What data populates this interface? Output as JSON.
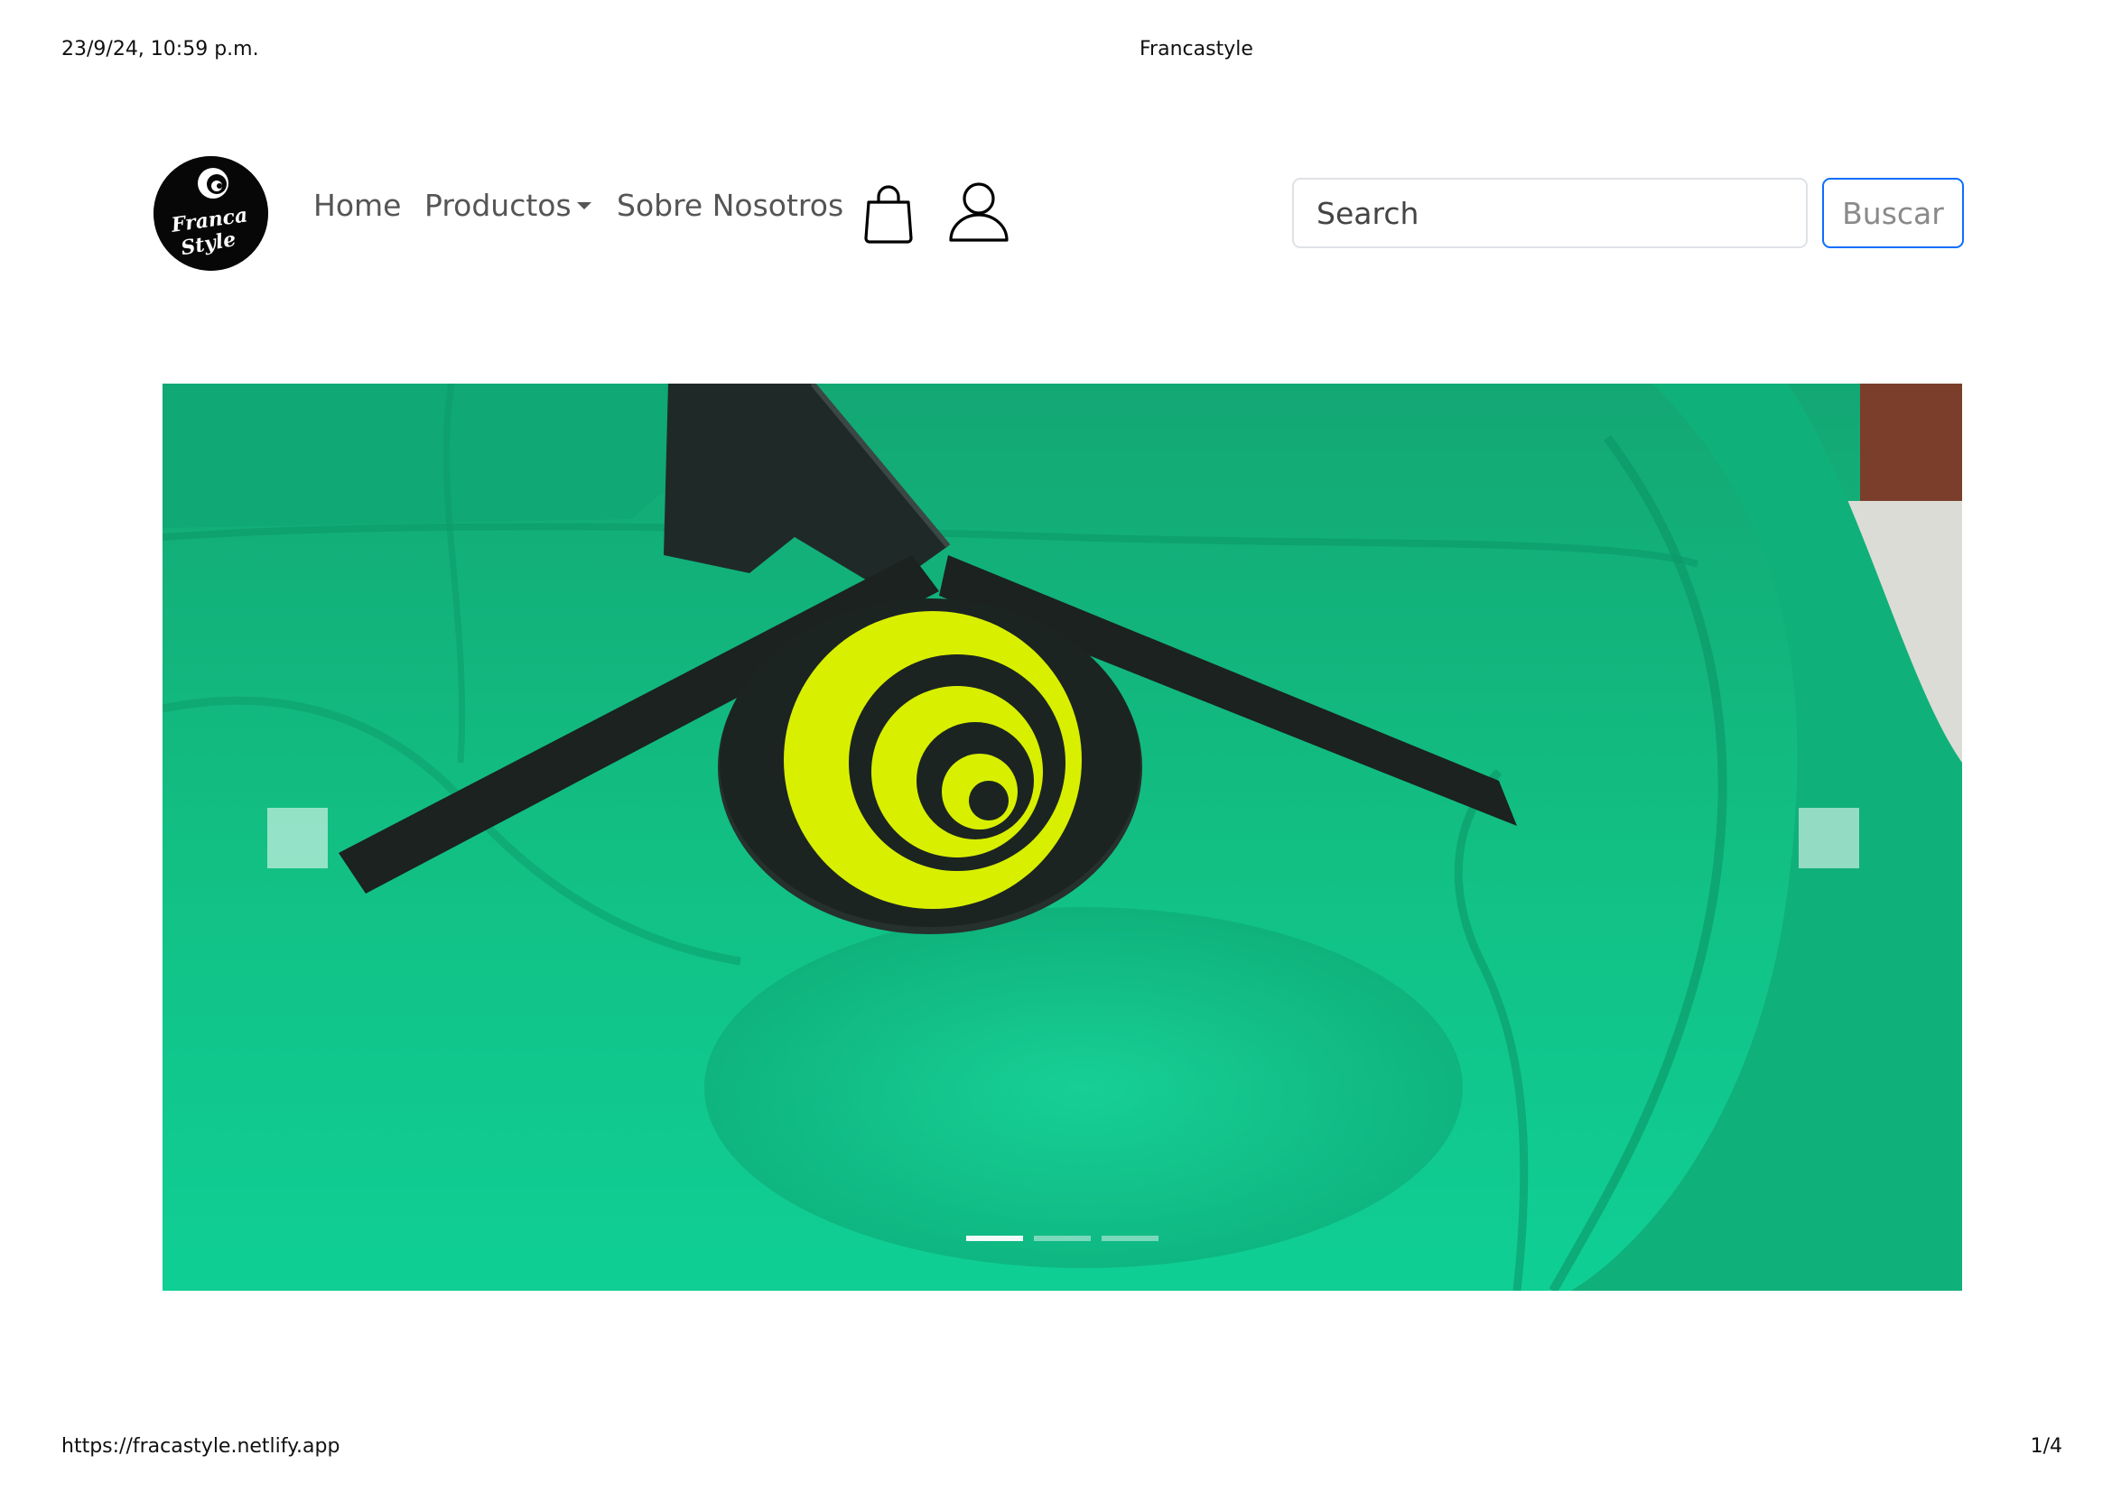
{
  "print_header": {
    "datetime": "23/9/24, 10:59 p.m.",
    "title": "Francastyle"
  },
  "print_footer": {
    "url": "https://fracastyle.netlify.app",
    "page": "1/4"
  },
  "navbar": {
    "brand": {
      "logo_text_line1": "Franca",
      "logo_text_line2": "Style"
    },
    "links": [
      {
        "label": "Home"
      },
      {
        "label": "Productos"
      },
      {
        "label": "Sobre Nosotros"
      }
    ],
    "icons": {
      "cart": "shopping-bag-icon",
      "user": "user-icon"
    },
    "search": {
      "placeholder": "Search",
      "value": "",
      "button_label": "Buscar"
    }
  },
  "carousel": {
    "slide_count": 3,
    "active_index": 0,
    "controls": [
      "previous",
      "next"
    ]
  },
  "colors": {
    "hoodie_green": "#14b97f",
    "logo_yellow": "#d8f000",
    "search_button_border": "#0d6efd"
  }
}
